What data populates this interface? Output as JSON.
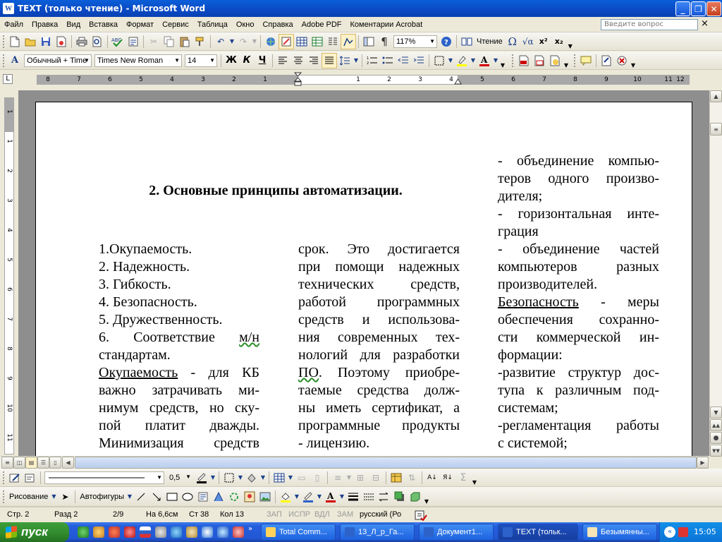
{
  "window": {
    "title": "TEXT (только чтение) - Microsoft Word",
    "app_icon": "W"
  },
  "menu": {
    "items": [
      "Файл",
      "Правка",
      "Вид",
      "Вставка",
      "Формат",
      "Сервис",
      "Таблица",
      "Окно",
      "Справка",
      "Adobe PDF",
      "Коментарии Acrobat"
    ],
    "ask_placeholder": "Введите вопрос",
    "close_glyph": "×"
  },
  "standard_toolbar": {
    "zoom": "117%",
    "reading_label": "Чтение",
    "icons": [
      "new-document-icon",
      "open-folder-icon",
      "save-icon",
      "permission-icon",
      "print-icon",
      "print-preview-icon",
      "spelling-icon",
      "cut-icon",
      "copy-icon",
      "paste-icon",
      "format-painter-icon",
      "undo-icon",
      "redo-icon",
      "hyperlink-icon",
      "tables-borders-icon",
      "insert-table-icon",
      "insert-excel-icon",
      "columns-icon",
      "drawing-icon",
      "document-map-icon",
      "show-hide-icon",
      "help-icon",
      "reading-icon",
      "symbol-icon",
      "equation-icon",
      "superscript-icon",
      "subscript-icon"
    ]
  },
  "formatting_toolbar": {
    "style": "Обычный + Time",
    "font": "Times New Roman",
    "size": "14",
    "bold": "Ж",
    "italic": "К",
    "underline": "Ч"
  },
  "ruler": {
    "labels": [
      "8",
      "7",
      "6",
      "5",
      "4",
      "3",
      "2",
      "1",
      "1",
      "2",
      "3",
      "4",
      "5",
      "6",
      "7",
      "8",
      "9",
      "10",
      "11",
      "12"
    ],
    "vertical_labels": [
      "1",
      "1",
      "2",
      "3",
      "4",
      "5",
      "6",
      "7",
      "8",
      "9",
      "10",
      "11"
    ]
  },
  "document": {
    "heading": "2. Основные принципы автоматизации.",
    "col1": [
      {
        "text": "1.Окупаемость.",
        "j": false
      },
      {
        "text": "2. Надежность.",
        "j": false
      },
      {
        "text": "3. Гибкость.",
        "j": false
      },
      {
        "text": "4. Безопасность.",
        "j": false
      },
      {
        "text": "5. Дружественность.",
        "j": false
      },
      {
        "text": "6. Соответствие м/н",
        "j": true
      },
      {
        "text": "стандартам.",
        "j": false
      },
      {
        "text": "Окупаемость - для КБ",
        "j": true
      },
      {
        "text": "важно затрачивать ми-",
        "j": true
      },
      {
        "text": "нимум средств, но ску-",
        "j": true
      },
      {
        "text": "пой платит дважды.",
        "j": true
      },
      {
        "text": "Минимизация средств",
        "j": true
      }
    ],
    "col2": [
      {
        "text": "срок. Это достигается",
        "j": true
      },
      {
        "text": "при помощи надежных",
        "j": true
      },
      {
        "text": "технических средств,",
        "j": true
      },
      {
        "text": "работой программных",
        "j": true
      },
      {
        "text": "средств и использова-",
        "j": true
      },
      {
        "text": "ния современных тех-",
        "j": true
      },
      {
        "text": "нологий для разработки",
        "j": true
      },
      {
        "text": "ПО. Поэтому приобре-",
        "j": true
      },
      {
        "text": "таемые средства долж-",
        "j": true
      },
      {
        "text": "ны иметь сертификат, а",
        "j": true
      },
      {
        "text": "программные продукты",
        "j": true
      },
      {
        "text": "- лицензию.",
        "j": false
      }
    ],
    "col3": [
      {
        "text": "- объединение компью-",
        "j": true
      },
      {
        "text": "теров одного произво-",
        "j": true
      },
      {
        "text": "дителя;",
        "j": false
      },
      {
        "text": "- горизонтальная инте-",
        "j": true
      },
      {
        "text": "грация",
        "j": false
      },
      {
        "text": "- объединение частей",
        "j": true
      },
      {
        "text": "компьютеров разных",
        "j": true
      },
      {
        "text": "производителей.",
        "j": false
      },
      {
        "text": "Безопасность - меры",
        "j": true
      },
      {
        "text": "обеспечения сохранно-",
        "j": true
      },
      {
        "text": "сти коммерческой ин-",
        "j": true
      },
      {
        "text": "формации:",
        "j": false
      },
      {
        "text": "-развитие структур дос-",
        "j": true
      },
      {
        "text": "тупа к различным под-",
        "j": true
      },
      {
        "text": "системам;",
        "j": false
      },
      {
        "text": "-регламентация работы",
        "j": true
      },
      {
        "text": "с системой;",
        "j": false
      }
    ],
    "underlined_terms": [
      "Окупаемость",
      "Безопасность"
    ],
    "spellcheck_terms": [
      "м/н",
      "ПО"
    ]
  },
  "drawing_toolbar": {
    "drawing_label": "Рисование",
    "autoshapes_label": "Автофигуры",
    "line_width": "0,5"
  },
  "status": {
    "page": "Стр. 2",
    "section": "Разд 2",
    "pages": "2/9",
    "position": "На 6,6см",
    "line": "Ст 38",
    "col": "Кол 13",
    "rec": "ЗАП",
    "trk": "ИСПР",
    "ext": "ВДЛ",
    "ovr": "ЗАМ",
    "lang": "русский (Ро"
  },
  "taskbar": {
    "start": "пуск",
    "tasks": [
      {
        "label": "Total Comm..."
      },
      {
        "label": "13_Л_р_Га..."
      },
      {
        "label": "Документ1..."
      },
      {
        "label": "TEXT (тольк..."
      },
      {
        "label": "Безымянны..."
      }
    ],
    "clock": "15:05"
  },
  "colors": {
    "titlebar": "#0a49c4",
    "taskbar": "#245edc",
    "start": "#2f8a2c",
    "spell_underline": "#2a8f2a"
  }
}
